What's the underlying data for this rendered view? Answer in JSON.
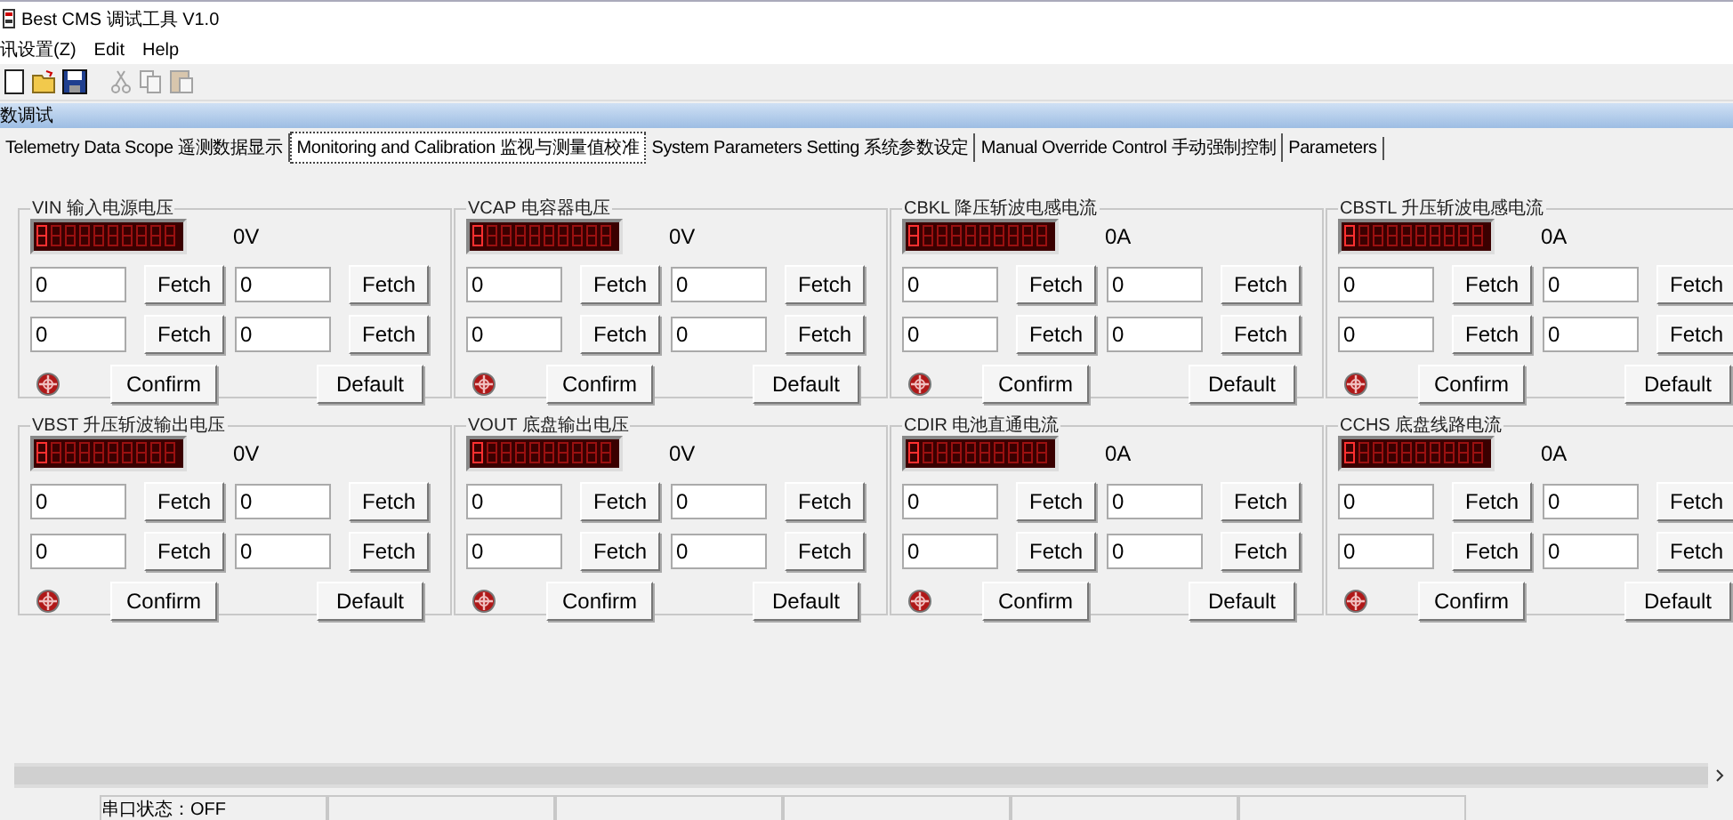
{
  "window": {
    "title": "Best CMS 调试工具 V1.0"
  },
  "menu": [
    {
      "label": "讯设置(Z)"
    },
    {
      "label": "Edit"
    },
    {
      "label": "Help"
    }
  ],
  "toolbar": [
    {
      "kind": "new",
      "disabled": false
    },
    {
      "kind": "open",
      "disabled": false
    },
    {
      "kind": "save",
      "disabled": false
    },
    {
      "kind": "cut",
      "disabled": true
    },
    {
      "kind": "copy",
      "disabled": true
    },
    {
      "kind": "paste",
      "disabled": true
    }
  ],
  "panel": {
    "title": "数调试"
  },
  "tabs": [
    {
      "label": "Telemetry Data Scope 遥测数据显示",
      "selected": false
    },
    {
      "label": "Monitoring and Calibration 监视与测量值校准",
      "selected": true
    },
    {
      "label": "System Parameters Setting 系统参数设定",
      "selected": false
    },
    {
      "label": "Manual Override Control 手动强制控制",
      "selected": false
    },
    {
      "label": "Parameters",
      "selected": false
    }
  ],
  "groups": [
    {
      "title": "VIN 输入电源电压",
      "reading": "0V",
      "fields": [
        "0",
        "0",
        "0",
        "0"
      ],
      "fetch": [
        "Fetch",
        "Fetch",
        "Fetch",
        "Fetch"
      ],
      "confirm": "Confirm",
      "default": "Default"
    },
    {
      "title": "VCAP 电容器电压",
      "reading": "0V",
      "fields": [
        "0",
        "0",
        "0",
        "0"
      ],
      "fetch": [
        "Fetch",
        "Fetch",
        "Fetch",
        "Fetch"
      ],
      "confirm": "Confirm",
      "default": "Default"
    },
    {
      "title": "CBKL 降压斩波电感电流",
      "reading": "0A",
      "fields": [
        "0",
        "0",
        "0",
        "0"
      ],
      "fetch": [
        "Fetch",
        "Fetch",
        "Fetch",
        "Fetch"
      ],
      "confirm": "Confirm",
      "default": "Default"
    },
    {
      "title": "CBSTL 升压斩波电感电流",
      "reading": "0A",
      "fields": [
        "0",
        "0",
        "0",
        "0"
      ],
      "fetch": [
        "Fetch",
        "Fetch",
        "Fetch",
        "Fetch"
      ],
      "confirm": "Confirm",
      "default": "Default"
    },
    {
      "title": "VBST 升压斩波输出电压",
      "reading": "0V",
      "fields": [
        "0",
        "0",
        "0",
        "0"
      ],
      "fetch": [
        "Fetch",
        "Fetch",
        "Fetch",
        "Fetch"
      ],
      "confirm": "Confirm",
      "default": "Default"
    },
    {
      "title": "VOUT 底盘输出电压",
      "reading": "0V",
      "fields": [
        "0",
        "0",
        "0",
        "0"
      ],
      "fetch": [
        "Fetch",
        "Fetch",
        "Fetch",
        "Fetch"
      ],
      "confirm": "Confirm",
      "default": "Default"
    },
    {
      "title": "CDIR 电池直通电流",
      "reading": "0A",
      "fields": [
        "0",
        "0",
        "0",
        "0"
      ],
      "fetch": [
        "Fetch",
        "Fetch",
        "Fetch",
        "Fetch"
      ],
      "confirm": "Confirm",
      "default": "Default"
    },
    {
      "title": "CCHS 底盘线路电流",
      "reading": "0A",
      "fields": [
        "0",
        "0",
        "0",
        "0"
      ],
      "fetch": [
        "Fetch",
        "Fetch",
        "Fetch",
        "Fetch"
      ],
      "confirm": "Confirm",
      "default": "Default"
    }
  ],
  "status_bar": {
    "serial": "串口状态：OFF"
  }
}
